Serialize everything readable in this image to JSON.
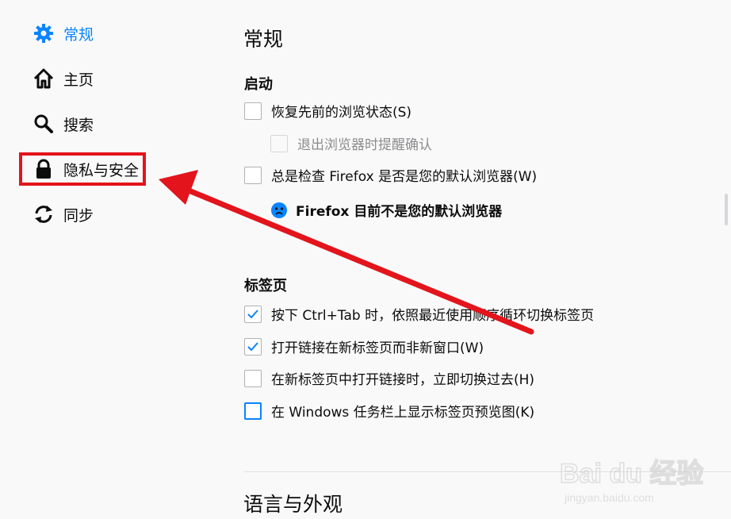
{
  "sidebar": {
    "items": [
      {
        "label": "常规",
        "icon": "gear-icon",
        "selected": true
      },
      {
        "label": "主页",
        "icon": "home-icon",
        "selected": false
      },
      {
        "label": "搜索",
        "icon": "search-icon",
        "selected": false
      },
      {
        "label": "隐私与安全",
        "icon": "lock-icon",
        "selected": false
      },
      {
        "label": "同步",
        "icon": "sync-icon",
        "selected": false
      }
    ]
  },
  "main": {
    "title": "常规",
    "startup": {
      "heading": "启动",
      "restore_session": {
        "label": "恢复先前的浏览状态(S)",
        "checked": false
      },
      "warn_on_quit": {
        "label": "退出浏览器时提醒确认",
        "checked": false,
        "disabled": true
      },
      "check_default": {
        "label": "总是检查 Firefox 是否是您的默认浏览器(W)",
        "checked": false
      },
      "default_status": "Firefox 目前不是您的默认浏览器"
    },
    "tabs": {
      "heading": "标签页",
      "items": [
        {
          "label": "按下 Ctrl+Tab 时，依照最近使用顺序循环切换标签页",
          "checked": true
        },
        {
          "label": "打开链接在新标签页而非新窗口(W)",
          "checked": true
        },
        {
          "label": "在新标签页中打开链接时，立即切换过去(H)",
          "checked": false
        },
        {
          "label": "在 Windows 任务栏上显示标签页预览图(K)",
          "checked": false
        }
      ]
    },
    "language_heading": "语言与外观"
  },
  "watermark": {
    "text": "Bai du 经验",
    "url_text": "jingyan.baidu.com"
  },
  "colors": {
    "accent": "#0a84ff",
    "annotation_red": "#e3141b"
  }
}
